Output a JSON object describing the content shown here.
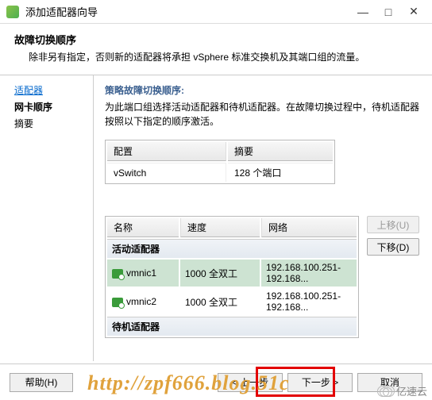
{
  "titlebar": {
    "icon": "vsphere-icon",
    "title": "添加适配器向导"
  },
  "header": {
    "title": "故障切换顺序",
    "desc": "除非另有指定，否则新的适配器将承担 vSphere 标准交换机及其端口组的流量。"
  },
  "sidebar": {
    "items": [
      {
        "label": "适配器",
        "link": true
      },
      {
        "label": "网卡顺序",
        "bold": true
      },
      {
        "label": "摘要"
      }
    ]
  },
  "policy": {
    "title": "策略故障切换顺序:",
    "desc": "为此端口组选择活动适配器和待机适配器。在故障切换过程中，待机适配器按照以下指定的顺序激活。"
  },
  "table1": {
    "headers": [
      "配置",
      "摘要"
    ],
    "rows": [
      {
        "config": "vSwitch",
        "summary": "128 个端口"
      }
    ]
  },
  "table2": {
    "headers": [
      "名称",
      "速度",
      "网络"
    ],
    "groups": [
      {
        "label": "活动适配器",
        "rows": [
          {
            "name": "vmnic1",
            "speed": "1000 全双工",
            "network": "192.168.100.251-192.168...",
            "selected": true
          },
          {
            "name": "vmnic2",
            "speed": "1000 全双工",
            "network": "192.168.100.251-192.168..."
          }
        ]
      },
      {
        "label": "待机适配器",
        "rows": []
      }
    ]
  },
  "moveButtons": {
    "up": "上移(U)",
    "down": "下移(D)"
  },
  "footer": {
    "help": "帮助(H)",
    "back": "< 上一步",
    "next": "下一步 >",
    "cancel": "取消"
  },
  "watermark": "http://zpf666.blog.51c",
  "logoText": "亿速云"
}
